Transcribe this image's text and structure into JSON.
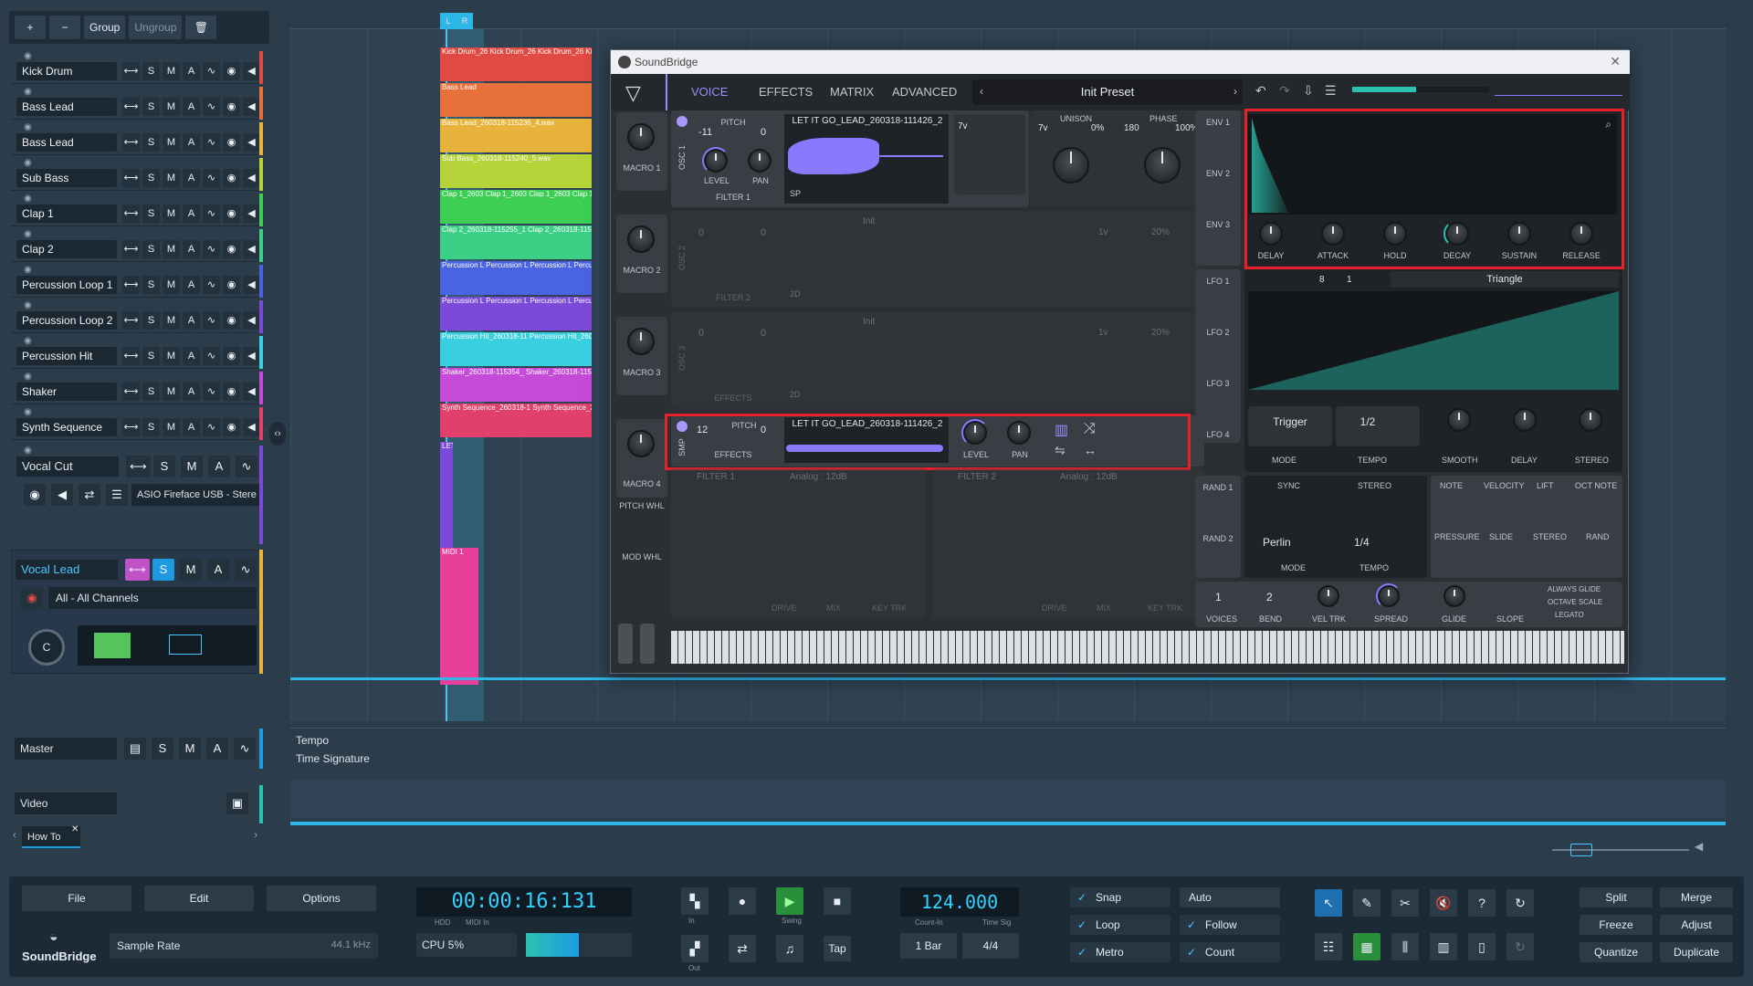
{
  "toolbar": {
    "add": "+",
    "remove": "−",
    "group": "Group",
    "ungroup": "Ungroup",
    "delete": "🗑"
  },
  "tracks": [
    {
      "name": "Kick Drum",
      "color": "#e04a43"
    },
    {
      "name": "Bass Lead",
      "color": "#e8703a"
    },
    {
      "name": "Bass Lead",
      "color": "#e8b33a"
    },
    {
      "name": "Sub Bass",
      "color": "#b6d43a"
    },
    {
      "name": "Clap 1",
      "color": "#3ccf54"
    },
    {
      "name": "Clap 2",
      "color": "#3ccf86"
    },
    {
      "name": "Percussion Loop 1",
      "color": "#4a63e0"
    },
    {
      "name": "Percussion Loop 2",
      "color": "#7b4ad8"
    },
    {
      "name": "Percussion Hit",
      "color": "#3acfe0"
    },
    {
      "name": "Shaker",
      "color": "#c54ad8"
    },
    {
      "name": "Synth Sequence",
      "color": "#e0406a"
    }
  ],
  "track_buttons": {
    "s": "S",
    "m": "M",
    "a": "A"
  },
  "vocal_cut": {
    "name": "Vocal Cut",
    "output": "ASIO Fireface USB - Stere"
  },
  "vocal_lead": {
    "name": "Vocal Lead",
    "input": "All - All Channels"
  },
  "master": {
    "name": "Master"
  },
  "video": {
    "name": "Video"
  },
  "howto": {
    "tab": "How To"
  },
  "lanes": {
    "tempo": "Tempo",
    "time_signature": "Time Signature"
  },
  "timeline": {
    "loop_l": "L",
    "loop_r": "R"
  },
  "clips": [
    {
      "label": "Kick Drum_26 Kick Drum_26 Kick Drum_26 Kick Drum_2",
      "color": "#e04a43"
    },
    {
      "label": "Bass Lead",
      "color": "#e8703a"
    },
    {
      "label": "Bass Lead_260318-115236_4.wav",
      "color": "#e8b33a"
    },
    {
      "label": "Sub Bass_260318-115240_5.wav",
      "color": "#b6d43a"
    },
    {
      "label": "Clap 1_2603 Clap 1_2603 Clap 1_2603 Clap 1_2603",
      "color": "#3ccf54"
    },
    {
      "label": "Clap 2_260318-115255_1 Clap 2_260318-115255_",
      "color": "#3ccf86"
    },
    {
      "label": "Percussion L Percussion L Percussion L Percussion L",
      "color": "#4a63e0"
    },
    {
      "label": "Percussion L Percussion L Percussion L Percussion L",
      "color": "#7b4ad8"
    },
    {
      "label": "Percussion Hit_260318-11 Percussion Hit_260318-11",
      "color": "#3acfe0"
    },
    {
      "label": "Shaker_260318-115354_ Shaker_260318-115354_",
      "color": "#c54ad8"
    },
    {
      "label": "Synth Sequence_260318-1 Synth Sequence_260318-",
      "color": "#e0406a"
    }
  ],
  "extra_clips": {
    "vocal_cut": "LET",
    "midi": "MIDI 1"
  },
  "synth": {
    "title": "SoundBridge",
    "tabs": [
      "VOICE",
      "EFFECTS",
      "MATRIX",
      "ADVANCED"
    ],
    "preset": "Init Preset",
    "macros": [
      "MACRO 1",
      "MACRO 2",
      "MACRO 3",
      "MACRO 4"
    ],
    "wheels": [
      "PITCH WHL",
      "MOD WHL"
    ],
    "osc1": {
      "label": "OSC 1",
      "pitch_label": "PITCH",
      "pitch": "-11",
      "pitch_fine": "0",
      "sample": "LET IT GO_LEAD_260318-111426_2",
      "level": "LEVEL",
      "pan": "PAN",
      "filter": "FILTER 1",
      "mode": "SP",
      "unison_label": "UNISON",
      "unison_voices": "7v",
      "unison": "0%",
      "phase_label": "PHASE",
      "phase": "180",
      "phase_rand": "100%"
    },
    "osc2": {
      "label": "OSC 2",
      "pitch": "0",
      "pitch_fine": "0",
      "sample": "Init",
      "filter": "FILTER 2",
      "mode": "2D",
      "unison_voices": "1v",
      "unison": "20%",
      "phase": "180",
      "phase_rand": "100%"
    },
    "osc3": {
      "label": "OSC 3",
      "pitch": "0",
      "pitch_fine": "0",
      "sample": "Init",
      "filter": "EFFECTS",
      "mode": "2D",
      "unison_voices": "1v",
      "unison": "20%",
      "phase": "180",
      "phase_rand": "100%"
    },
    "smp": {
      "label": "SMP",
      "pitch": "12",
      "pitch_fine": "0",
      "pitch_label": "PITCH",
      "sample": "LET IT GO_LEAD_260318-111426_2",
      "route": "EFFECTS",
      "level": "LEVEL",
      "pan": "PAN"
    },
    "filters": [
      {
        "name": "FILTER 1",
        "type": "Analog : 12dB"
      },
      {
        "name": "FILTER 2",
        "type": "Analog : 12dB"
      }
    ],
    "filter_labels": [
      "DRIVE",
      "MIX",
      "KEY TRK"
    ],
    "env_labels": [
      "ENV 1",
      "ENV 2",
      "ENV 3"
    ],
    "env_knobs": [
      "DELAY",
      "ATTACK",
      "HOLD",
      "DECAY",
      "SUSTAIN",
      "RELEASE"
    ],
    "lfo_labels": [
      "LFO 1",
      "LFO 2",
      "LFO 3",
      "LFO 4"
    ],
    "lfo": {
      "steps": "8",
      "rate": "1",
      "shape": "Triangle",
      "mode": "Trigger",
      "tempo": "1/2",
      "labels": [
        "MODE",
        "TEMPO",
        "SMOOTH",
        "DELAY",
        "STEREO"
      ]
    },
    "rand_labels": [
      "RAND 1",
      "RAND 2"
    ],
    "rand": {
      "sync": "SYNC",
      "stereo": "STEREO",
      "mode": "Perlin",
      "tempo": "1/4",
      "mode_label": "MODE",
      "tempo_label": "TEMPO"
    },
    "mpe": [
      "NOTE",
      "VELOCITY",
      "LIFT",
      "OCT NOTE",
      "PRESSURE",
      "SLIDE",
      "STEREO",
      "RAND"
    ],
    "voice": {
      "voices": "1",
      "bend": "2",
      "labels": [
        "VOICES",
        "BEND",
        "VEL TRK",
        "SPREAD",
        "GLIDE",
        "SLOPE"
      ],
      "always_glide": "ALWAYS GLIDE",
      "octave_scale": "OCTAVE SCALE",
      "legato": "LEGATO"
    }
  },
  "transport": {
    "file": "File",
    "edit": "Edit",
    "options": "Options",
    "brand": "SoundBridge",
    "sample_rate_label": "Sample Rate",
    "sample_rate": "44.1 kHz",
    "time": "00:00:16:131",
    "hdd": "HDD",
    "midi_in": "MIDI In",
    "cpu": "CPU 5%",
    "in": "In",
    "out": "Out",
    "swing": "Swing",
    "tap": "Tap",
    "tempo": "124.000",
    "count_in_label": "Count-In",
    "count_in": "1 Bar",
    "time_sig_label": "Time Sig",
    "time_sig": "4/4",
    "snap": "Snap",
    "loop": "Loop",
    "metro": "Metro",
    "auto": "Auto",
    "follow": "Follow",
    "count": "Count",
    "split": "Split",
    "merge": "Merge",
    "freeze": "Freeze",
    "adjust": "Adjust",
    "quantize": "Quantize",
    "duplicate": "Duplicate",
    "help": "?"
  },
  "colors": {
    "accent": "#8a78ff",
    "teal": "#29c2b0",
    "highlight": "#e8202a",
    "lcd": "#33d2ff"
  }
}
